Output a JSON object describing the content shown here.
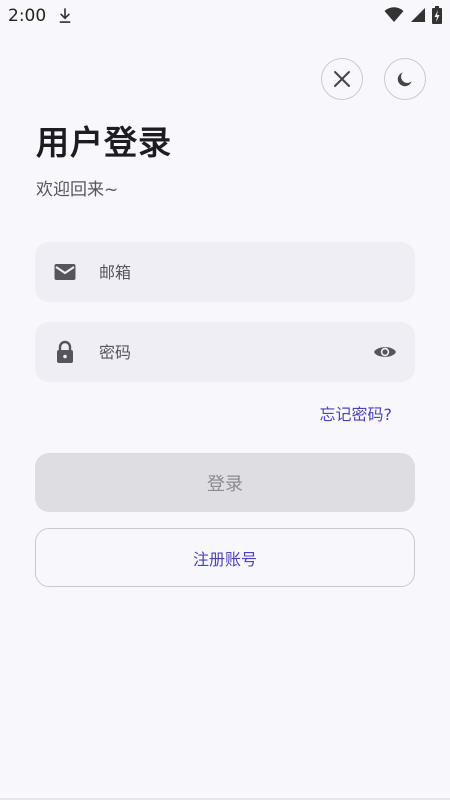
{
  "status_bar": {
    "time": "2:00",
    "icons": [
      "download-icon",
      "wifi-icon",
      "signal-icon",
      "battery-charging-icon"
    ]
  },
  "top_actions": {
    "close_icon": "close-icon",
    "theme_icon": "moon-icon"
  },
  "login": {
    "title": "用户登录",
    "subtitle": "欢迎回来~",
    "email_placeholder": "邮箱",
    "email_icon": "mail-icon",
    "password_placeholder": "密码",
    "password_icon": "lock-icon",
    "password_toggle_icon": "eye-icon",
    "forgot_password": "忘记密码?",
    "login_button": "登录",
    "register_button": "注册账号"
  },
  "colors": {
    "background": "#f8f8fc",
    "field_background": "#eeeef4",
    "accent": "#4a44b8",
    "disabled_button": "#dddde2",
    "disabled_text": "#8a8a90"
  }
}
